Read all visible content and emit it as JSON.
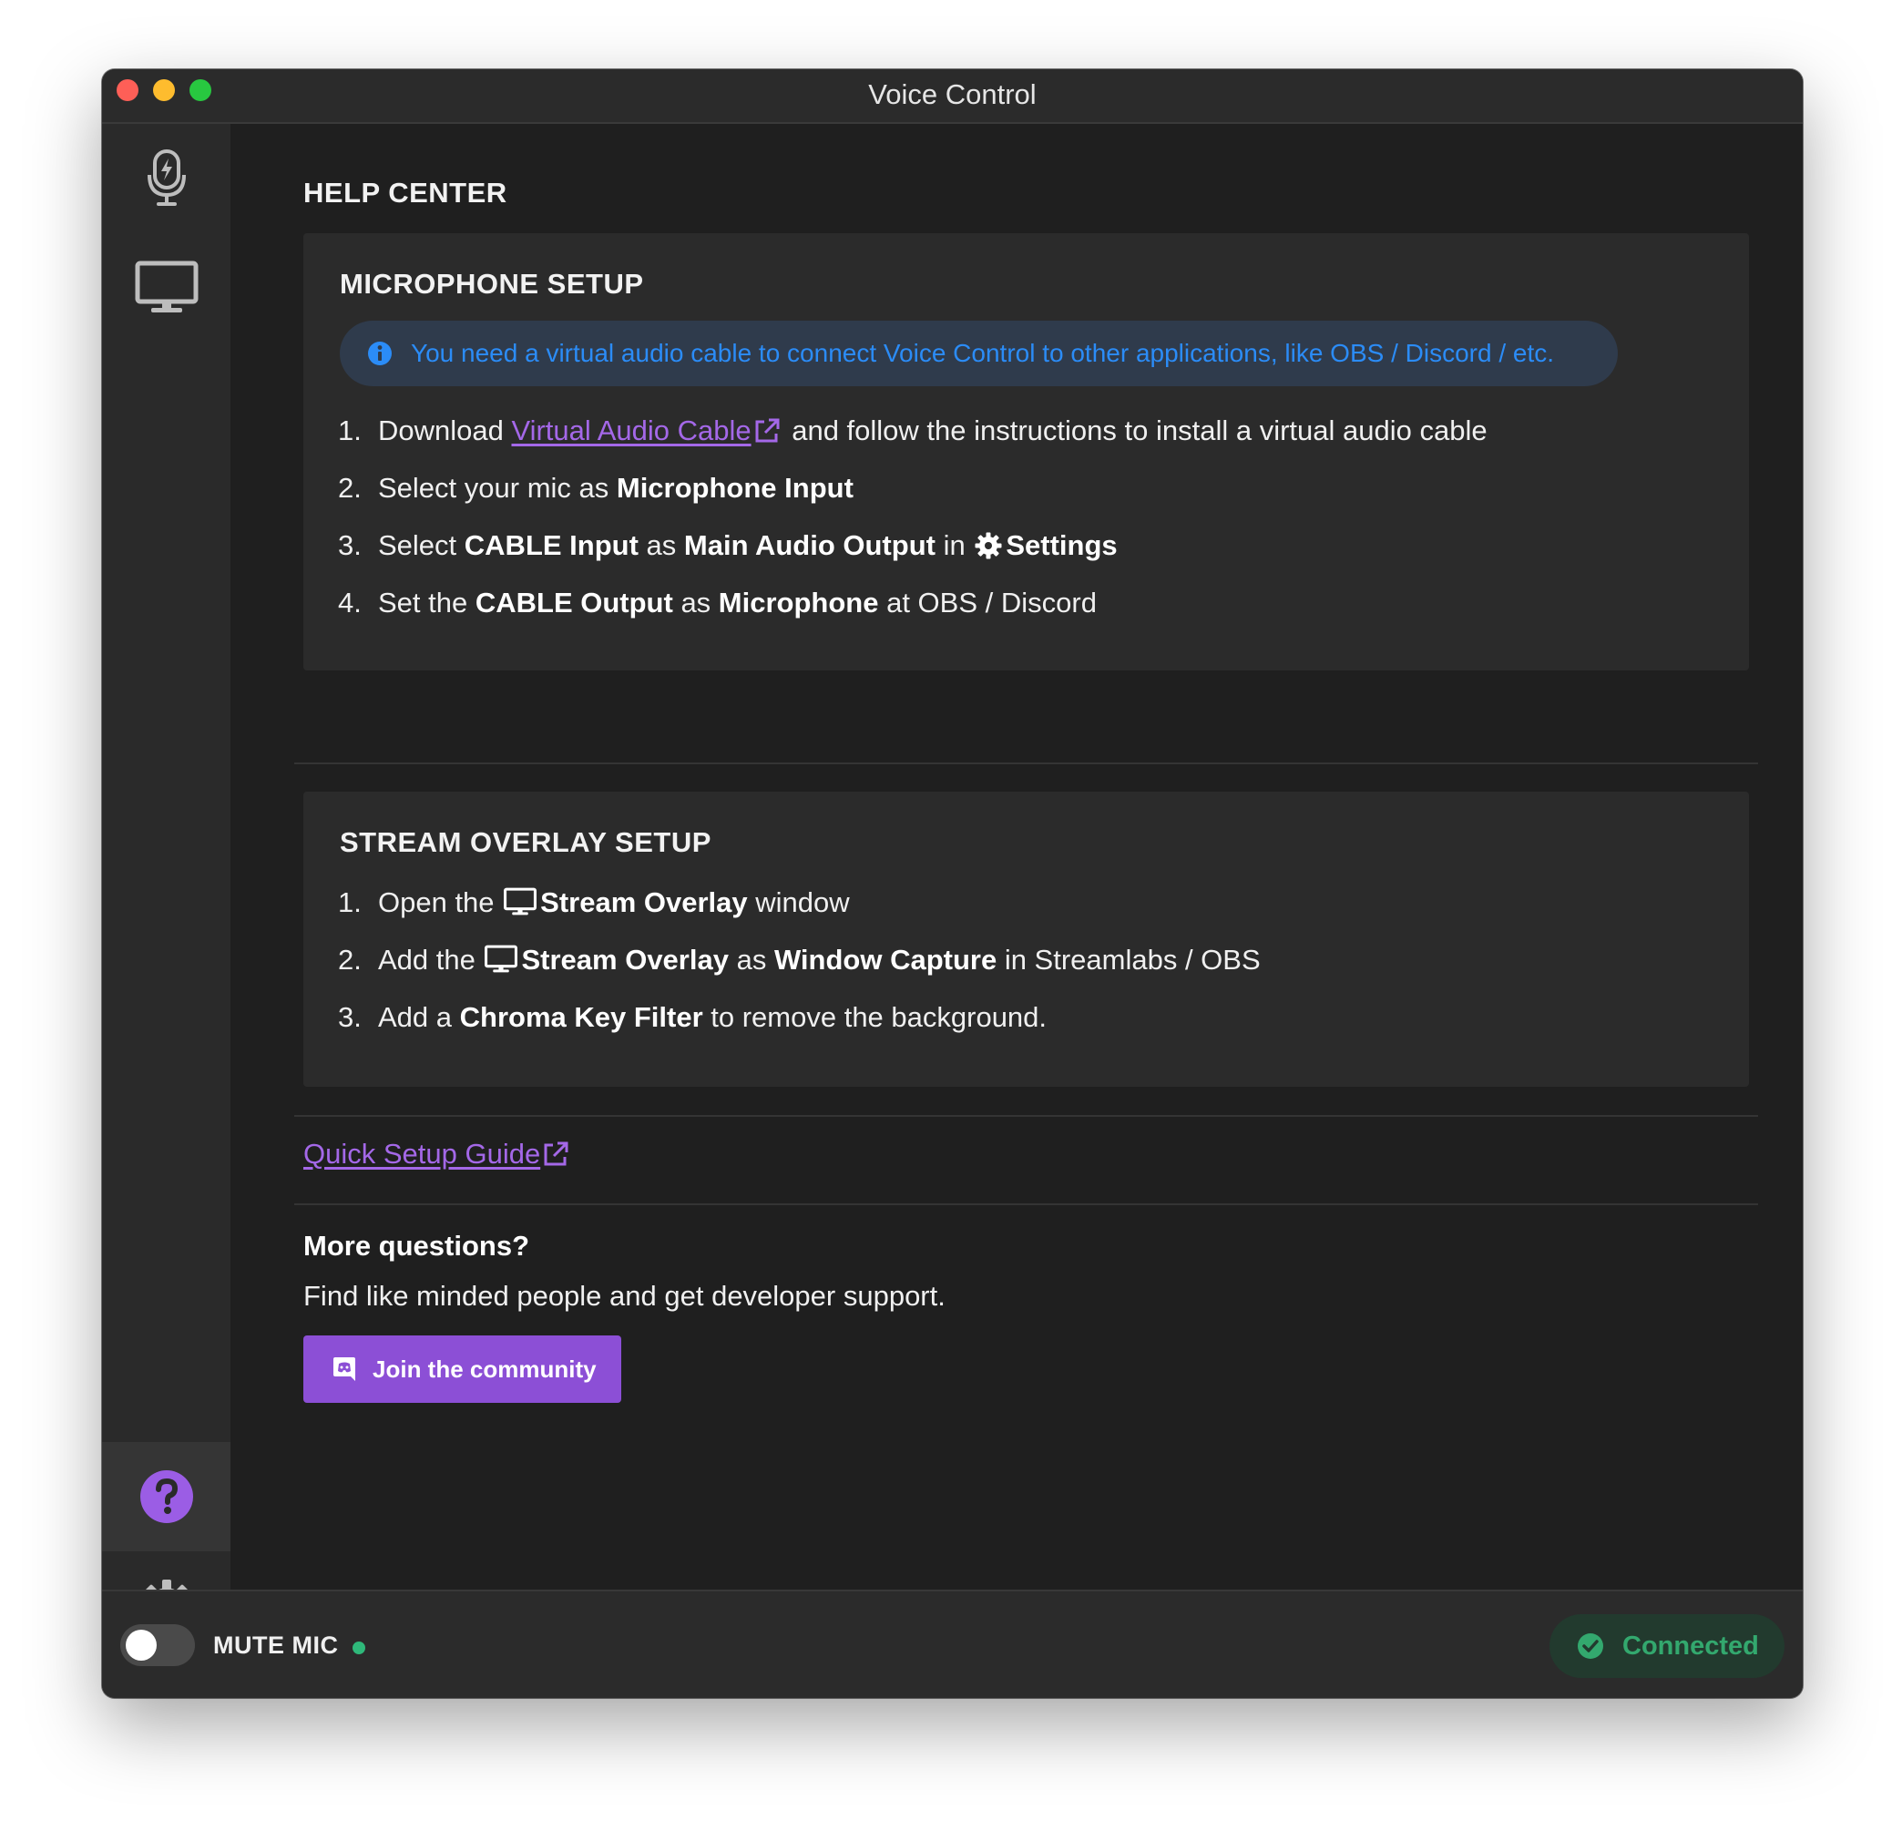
{
  "window": {
    "title": "Voice Control"
  },
  "sidebar": {
    "items": [
      {
        "icon": "microphone-bolt-icon",
        "active": false
      },
      {
        "icon": "monitor-icon",
        "active": false
      },
      {
        "icon": "help-icon",
        "active": true
      },
      {
        "icon": "gear-icon",
        "active": false
      }
    ]
  },
  "colors": {
    "accent": "#8c4fd6",
    "link": "#a468e8",
    "info_text": "#2b8cf7",
    "success": "#33a86e"
  },
  "help": {
    "heading": "HELP CENTER",
    "mic_setup": {
      "title": "MICROPHONE SETUP",
      "info": "You need a virtual audio cable to connect Voice Control to other applications, like OBS / Discord / etc.",
      "steps": [
        {
          "num": "1.",
          "t1": "Download ",
          "link": "Virtual Audio Cable",
          "t2": " and follow the instructions to install a virtual audio cable"
        },
        {
          "num": "2.",
          "t1": "Select your mic as ",
          "b1": "Microphone Input"
        },
        {
          "num": "3.",
          "t1": "Select ",
          "b1": "CABLE Input",
          "t2": " as ",
          "b2": "Main Audio Output",
          "t3": " in ",
          "b3": "Settings"
        },
        {
          "num": "4.",
          "t1": "Set the ",
          "b1": "CABLE Output",
          "t2": " as ",
          "b2": "Microphone",
          "t3": " at OBS / Discord"
        }
      ]
    },
    "overlay_setup": {
      "title": "STREAM OVERLAY SETUP",
      "steps": [
        {
          "num": "1.",
          "t1": "Open the ",
          "b1": "Stream Overlay",
          "t2": " window"
        },
        {
          "num": "2.",
          "t1": "Add the ",
          "b1": "Stream Overlay",
          "t2": " as ",
          "b2": "Window Capture",
          "t3": " in Streamlabs / OBS"
        },
        {
          "num": "3.",
          "t1": "Add a ",
          "b1": "Chroma Key Filter",
          "t2": " to remove the background."
        }
      ]
    },
    "quick_guide": "Quick Setup Guide",
    "more_title": "More questions?",
    "more_text": "Find like minded people and get developer support.",
    "join_label": "Join the community"
  },
  "footer": {
    "mute_label": "MUTE MIC",
    "mute_on": false,
    "status": "Connected"
  }
}
